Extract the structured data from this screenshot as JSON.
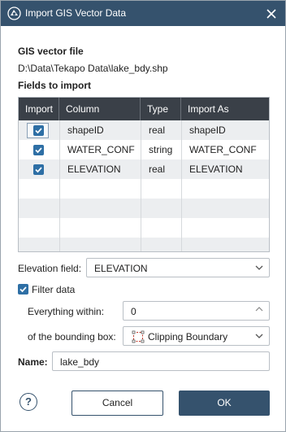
{
  "window": {
    "title": "Import GIS Vector Data"
  },
  "gis_file": {
    "heading": "GIS vector file",
    "path": "D:\\Data\\Tekapo Data\\lake_bdy.shp"
  },
  "fields": {
    "heading": "Fields to import",
    "columns": [
      "Import",
      "Column",
      "Type",
      "Import As"
    ],
    "rows": [
      {
        "checked": true,
        "column": "shapeID",
        "type": "real",
        "import_as": "shapeID"
      },
      {
        "checked": true,
        "column": "WATER_CONF",
        "type": "string",
        "import_as": "WATER_CONF"
      },
      {
        "checked": true,
        "column": "ELEVATION",
        "type": "real",
        "import_as": "ELEVATION"
      }
    ]
  },
  "elevation_field": {
    "label": "Elevation field:",
    "value": "ELEVATION"
  },
  "filter": {
    "label": "Filter data",
    "checked": true,
    "within_label": "Everything within:",
    "within_value": "0",
    "bbox_label": "of the bounding box:",
    "bbox_value": "Clipping Boundary"
  },
  "name": {
    "label": "Name:",
    "value": "lake_bdy"
  },
  "buttons": {
    "help": "?",
    "cancel": "Cancel",
    "ok": "OK"
  },
  "colors": {
    "titlebar": "#35526d",
    "header": "#3a4048",
    "accent": "#2e6fa5"
  },
  "icons": [
    "app-icon",
    "close-icon",
    "chevron-down-icon",
    "spinner-up-icon",
    "clipping-boundary-icon",
    "checkbox-checked-icon",
    "help-icon"
  ]
}
